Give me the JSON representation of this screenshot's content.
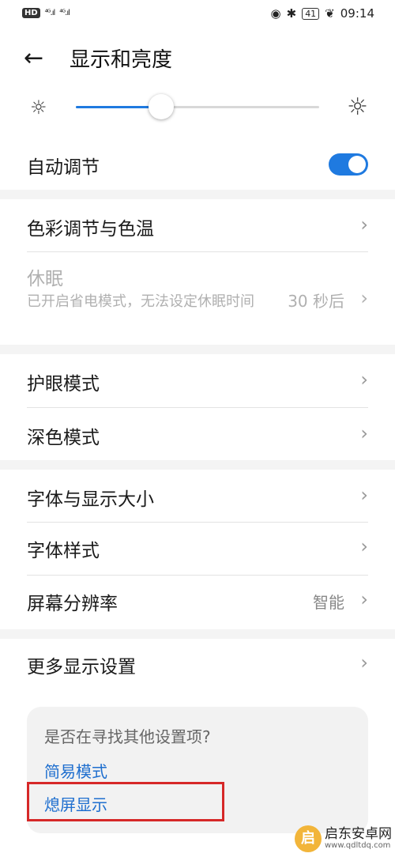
{
  "status_bar": {
    "hd": "HD",
    "sig1": "⁴ᴳ.ıl",
    "sig2": "⁴ᴳ.ıl",
    "battery": "41",
    "time": "09:14"
  },
  "header": {
    "title": "显示和亮度"
  },
  "brightness": {
    "level": 0.35
  },
  "auto_adjust": {
    "label": "自动调节",
    "on": true
  },
  "section1": {
    "color_temp": "色彩调节与色温",
    "sleep_title": "休眠",
    "sleep_sub": "已开启省电模式，无法设定休眠时间",
    "sleep_value": "30 秒后"
  },
  "section2": {
    "eye_mode": "护眼模式",
    "dark_mode": "深色模式"
  },
  "section3": {
    "font_size": "字体与显示大小",
    "font_style": "字体样式",
    "resolution": "屏幕分辨率",
    "resolution_value": "智能"
  },
  "section4": {
    "more": "更多显示设置"
  },
  "suggest": {
    "question": "是否在寻找其他设置项?",
    "link1": "简易模式",
    "link2": "熄屏显示"
  },
  "watermark": {
    "name": "启东安卓网",
    "url": "www.qdltdq.com",
    "logo": "启"
  },
  "colors": {
    "accent": "#1f7ae0",
    "link": "#1f6fcf",
    "highlight": "#d62828"
  }
}
